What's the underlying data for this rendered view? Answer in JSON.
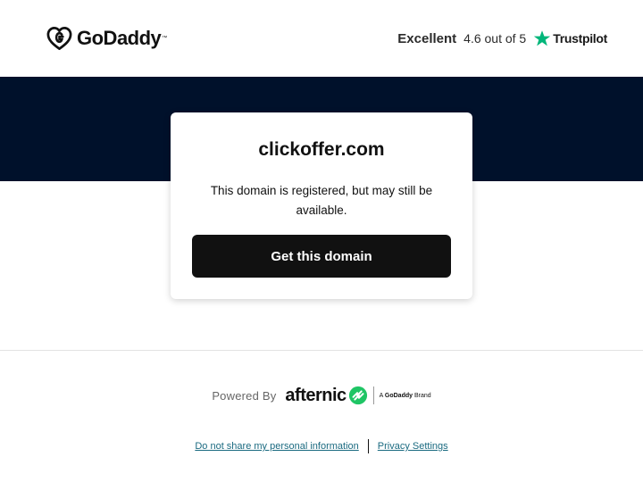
{
  "header": {
    "logo_text": "GoDaddy",
    "rating_label": "Excellent",
    "rating_score": "4.6 out of 5",
    "rating_provider": "Trustpilot",
    "icons": {
      "logo": "godaddy-logo-icon",
      "star": "trustpilot-star-icon"
    },
    "colors": {
      "star": "#00b67a"
    }
  },
  "hero": {
    "colors": {
      "band": "#00112b"
    }
  },
  "card": {
    "domain": "clickoffer.com",
    "status": "This domain is registered, but may still be available.",
    "cta_label": "Get this domain",
    "colors": {
      "cta_bg": "#111111",
      "cta_text": "#ffffff"
    }
  },
  "footer": {
    "powered_by": "Powered By",
    "brand_word": "afternic",
    "brand_tag_prefix": "A",
    "brand_tag_name": "GoDaddy",
    "brand_tag_suffix": "Brand",
    "links": [
      "Do not share my personal information",
      "Privacy Settings"
    ],
    "icons": {
      "brand": "afternic-logo-icon"
    },
    "colors": {
      "brand_icon": "#1fc565",
      "link": "#1a6a80"
    }
  }
}
